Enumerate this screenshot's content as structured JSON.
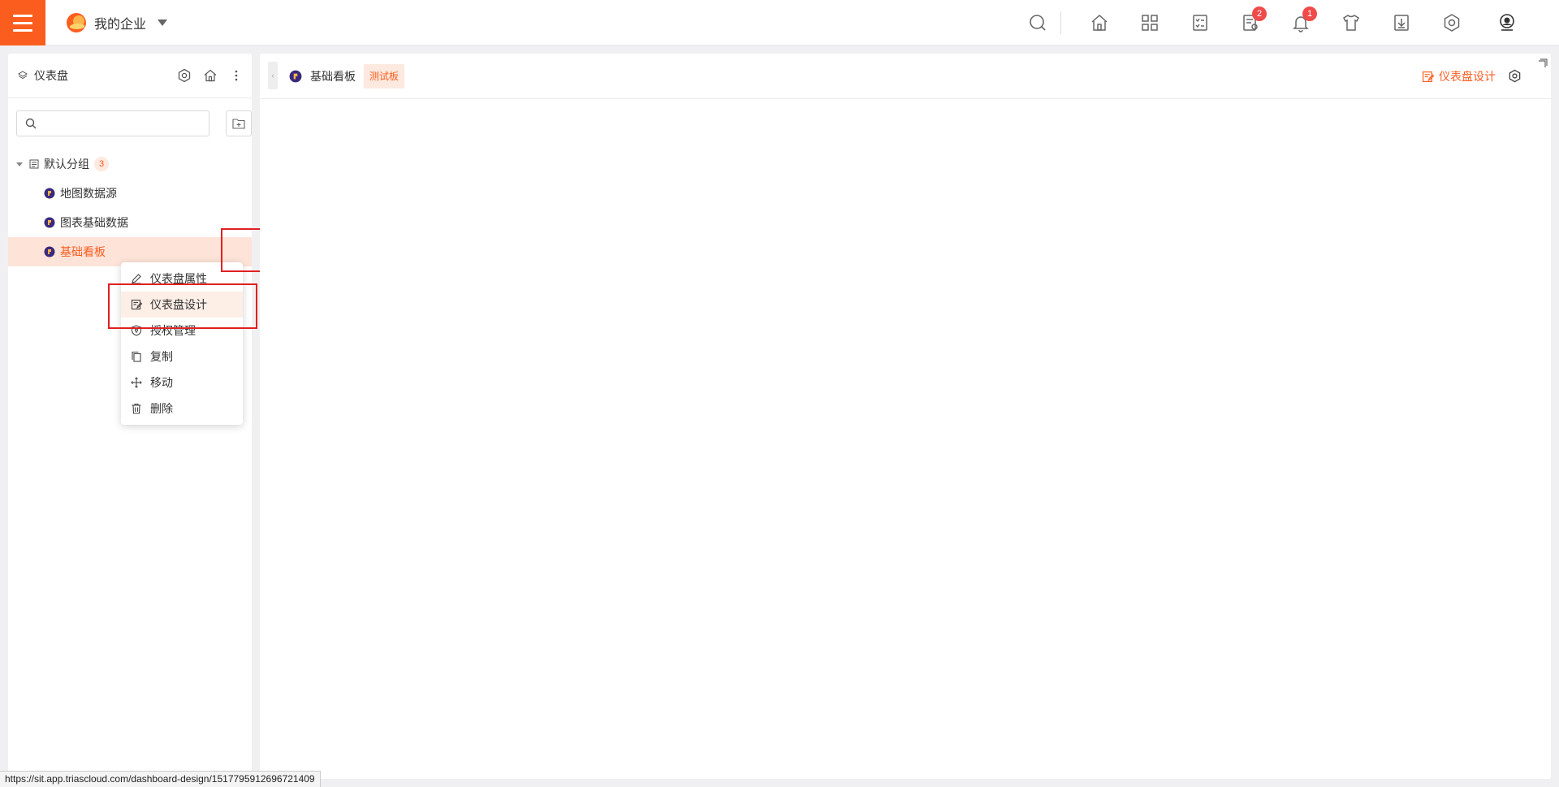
{
  "topbar": {
    "org_name": "我的企业",
    "task_badge": "2",
    "notify_badge": "1",
    "icons": [
      "search-icon",
      "home-icon",
      "apps-icon",
      "checklist-icon",
      "task-icon",
      "bell-icon",
      "shirt-icon",
      "download-icon",
      "gear-icon",
      "user-icon"
    ]
  },
  "sidebar": {
    "title": "仪表盘",
    "search_placeholder": "",
    "group": {
      "label": "默认分组",
      "count": "3"
    },
    "items": [
      {
        "label": "地图数据源"
      },
      {
        "label": "图表基础数据"
      },
      {
        "label": "基础看板"
      }
    ]
  },
  "context_menu": {
    "items": [
      {
        "label": "仪表盘属性",
        "icon": "edit-icon"
      },
      {
        "label": "仪表盘设计",
        "icon": "design-icon"
      },
      {
        "label": "授权管理",
        "icon": "shield-icon"
      },
      {
        "label": "复制",
        "icon": "copy-icon"
      },
      {
        "label": "移动",
        "icon": "move-icon"
      },
      {
        "label": "删除",
        "icon": "trash-icon"
      }
    ]
  },
  "main": {
    "title": "基础看板",
    "tag": "测试板",
    "design_label": "仪表盘设计"
  },
  "statusbar": {
    "url": "https://sit.app.triascloud.com/dashboard-design/1517795912696721409"
  },
  "colors": {
    "accent": "#fb5d1f",
    "highlight": "#fde3d8",
    "annotation_red": "#e02020",
    "badge_red": "#f04b4b"
  }
}
